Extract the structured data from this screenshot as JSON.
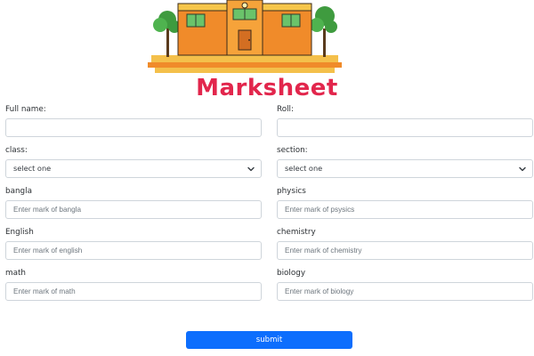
{
  "header": {
    "title": "Marksheet",
    "illustration": "school-building-icon",
    "colors": {
      "title": "#e2264c",
      "building_main": "#f08b2a",
      "building_roof": "#f6c64a",
      "tree": "#3f9b3f"
    }
  },
  "form": {
    "fields": {
      "full_name": {
        "label": "Full name:",
        "placeholder": ""
      },
      "roll": {
        "label": "Roll:",
        "placeholder": ""
      },
      "class": {
        "label": "class:",
        "selected": "select one"
      },
      "section": {
        "label": "section:",
        "selected": "select one"
      },
      "bangla": {
        "label": "bangla",
        "placeholder": "Enter mark of bangla"
      },
      "physics": {
        "label": "physics",
        "placeholder": "Enter mark of psysics"
      },
      "english": {
        "label": "English",
        "placeholder": "Enter mark of english"
      },
      "chemistry": {
        "label": "chemistry",
        "placeholder": "Enter mark of chemistry"
      },
      "math": {
        "label": "math",
        "placeholder": "Enter mark of math"
      },
      "biology": {
        "label": "biology",
        "placeholder": "Enter mark of biology"
      }
    },
    "submit": {
      "label": "submit",
      "color": "#0d6efd"
    }
  }
}
